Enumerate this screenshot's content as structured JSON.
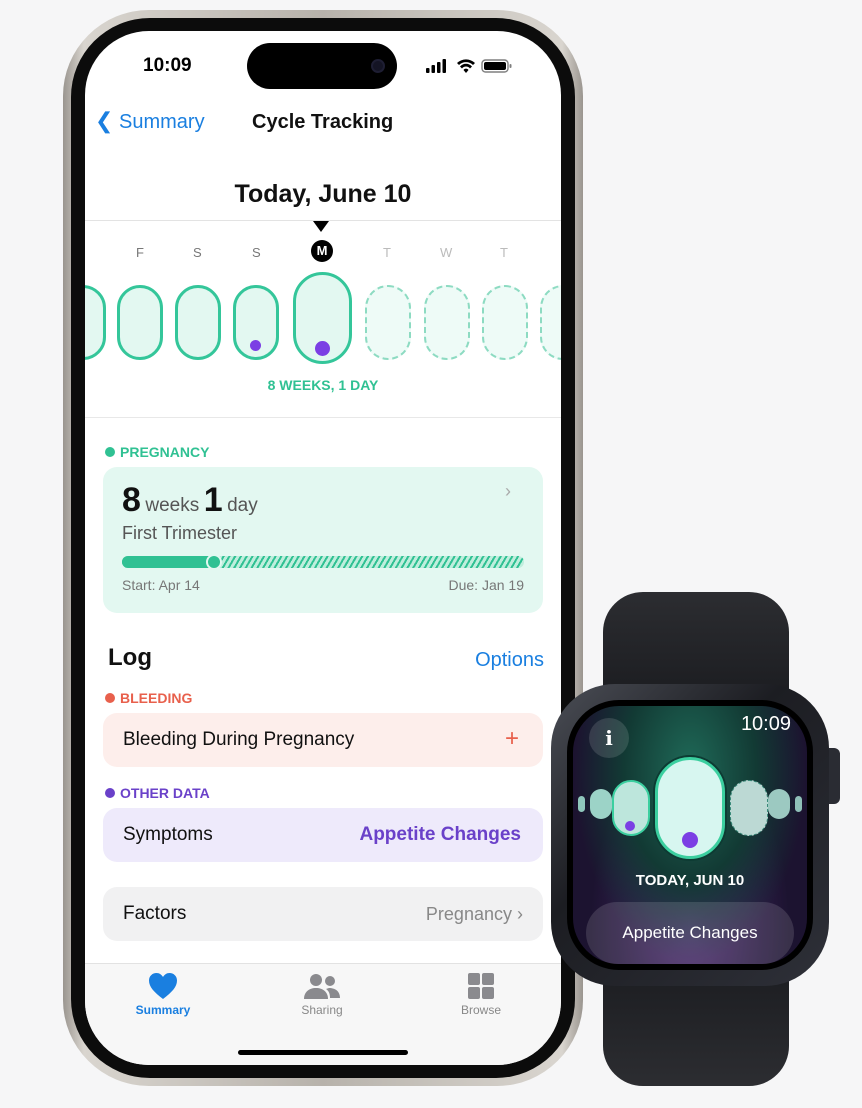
{
  "phone": {
    "status": {
      "time": "10:09"
    },
    "nav": {
      "back_label": "Summary",
      "title": "Cycle Tracking"
    },
    "date_header": "Today, June 10",
    "days": [
      "F",
      "S",
      "S",
      "M",
      "T",
      "W",
      "T"
    ],
    "selected_day": "M",
    "gestation_label": "8 WEEKS, 1 DAY",
    "pregnancy": {
      "section": "PREGNANCY",
      "weeks": "8",
      "weeks_unit": "weeks",
      "days": "1",
      "days_unit": "day",
      "trimester": "First Trimester",
      "start": "Start: Apr 14",
      "due": "Due: Jan 19",
      "progress_percent": 23
    },
    "log": {
      "title": "Log",
      "options_label": "Options",
      "bleeding_section": "BLEEDING",
      "bleeding_item": "Bleeding During Pregnancy",
      "add_symbol": "+",
      "other_section": "OTHER DATA",
      "symptoms_label": "Symptoms",
      "symptoms_value": "Appetite Changes",
      "factors_label": "Factors",
      "factors_value": "Pregnancy"
    },
    "tabs": [
      {
        "label": "Summary",
        "icon": "heart-icon",
        "active": true
      },
      {
        "label": "Sharing",
        "icon": "people-icon"
      },
      {
        "label": "Browse",
        "icon": "grid-icon"
      }
    ]
  },
  "watch": {
    "time": "10:09",
    "info_symbol": "i",
    "date": "TODAY, JUN 10",
    "button_label": "Appetite Changes"
  },
  "colors": {
    "accent": "#1a7fe0",
    "teal": "#30c193",
    "bleeding": "#e8604c",
    "purple": "#6a41c9"
  }
}
